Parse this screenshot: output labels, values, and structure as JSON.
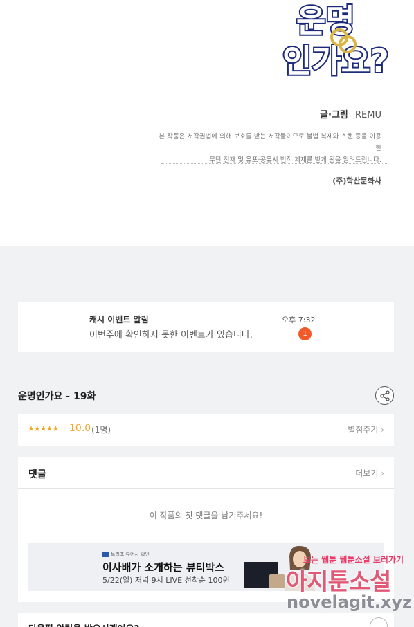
{
  "logo": {
    "line1": "운명",
    "line2": "인가요?"
  },
  "credits": {
    "role": "글·그림",
    "author": "REMU",
    "notice_line1": "본 작품은 저작권법에 의해 보호를 받는 저작물이므로 불법 복제와 스캔 등을 이용한",
    "notice_line2": "무단 전재 및 유포·공유시 법적 제재를 받게 됨을 알려드립니다.",
    "publisher": "(주)학산문화사"
  },
  "event": {
    "title": "캐시 이벤트 알림",
    "message": "이번주에 확인하지 못한 이벤트가 있습니다.",
    "time": "오후 7:32",
    "badge": "1"
  },
  "episode": {
    "title": "운명인가요 - 19화",
    "share_icon": "share-icon"
  },
  "rating": {
    "stars": "★★★★★",
    "score": "10.0",
    "count": "(1명)",
    "rate_label": "별점주기",
    "rate_icon": "chevron-right-icon"
  },
  "comments": {
    "heading": "댓글",
    "more_label": "더보기",
    "empty_text": "이 작품의 첫 댓글을 남겨주세요!"
  },
  "ad": {
    "brand": "트리초 뷰어시 확인",
    "title": "이사배가 소개하는 뷰티박스",
    "subtitle": "5/22(일) 저녁 9시 LIVE 선착순 100원"
  },
  "watermark": {
    "tagline": "보는 웹툰 웹툰소설 보러가기",
    "name": "아지툰소설",
    "url": "novelagit.xyz"
  },
  "next": {
    "question": "다음편 알림을 받으시겠어요?"
  },
  "colors": {
    "accent_orange": "#f5a623",
    "badge": "#f05a28",
    "logo_outline": "#1c2a7a"
  }
}
